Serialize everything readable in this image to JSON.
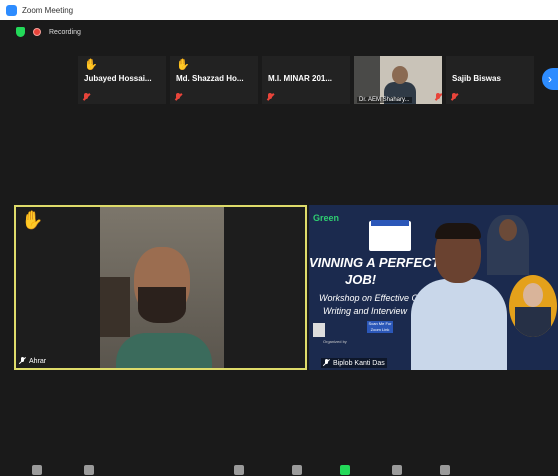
{
  "window": {
    "title": "Zoom Meeting"
  },
  "status": {
    "recording_label": "Recording"
  },
  "participants": [
    {
      "name": "Jubayed Hossai...",
      "hand_raised": true,
      "muted": true
    },
    {
      "name": "Md. Shazzad Ho...",
      "hand_raised": true,
      "muted": true
    },
    {
      "name": "M.I. MINAR 201...",
      "hand_raised": false,
      "muted": true
    },
    {
      "name": "Dr. AEM Shahary...",
      "hand_raised": false,
      "muted": true,
      "has_video": true
    },
    {
      "name": "Sajib Biswas",
      "hand_raised": false,
      "muted": true
    }
  ],
  "main": {
    "left_name": "Ahrar",
    "right_name": "Biplob Kanti Das"
  },
  "poster": {
    "logo": "Green",
    "headline_1": "VINNING A PERFECT",
    "headline_2": "JOB!",
    "line_1": "Workshop on Effective CV",
    "line_2": "Writing and Interview",
    "scan_label": "Scan Me For Zoom Link",
    "organized": "Organized by"
  },
  "colors": {
    "active_speaker_border": "#dedb6a",
    "zoom_blue": "#2d8cff",
    "muted_red": "#e8443a",
    "hand_yellow": "#f5c542"
  },
  "icons": {
    "hand": "raised-hand-icon",
    "mic_muted": "mic-muted-icon",
    "next": "chevron-right-icon"
  }
}
